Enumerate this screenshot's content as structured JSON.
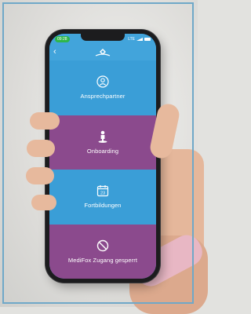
{
  "status_bar": {
    "time": "09:28",
    "carrier": "LTE"
  },
  "app_bar": {
    "back_icon": "chevron-left-icon",
    "logo": "medifox-logo"
  },
  "menu": [
    {
      "label": "Ansprechpartner",
      "icon": "contact-person-icon",
      "color": "#3a9ed7"
    },
    {
      "label": "Onboarding",
      "icon": "onboarding-person-icon",
      "color": "#8b4a8d"
    },
    {
      "label": "Fortbildungen",
      "icon": "calendar-icon",
      "color": "#3a9ed7",
      "icon_text": "23"
    },
    {
      "label": "MediFox Zugang gesperrt",
      "icon": "blocked-icon",
      "color": "#8b4a8d"
    }
  ],
  "colors": {
    "blue": "#3a9ed7",
    "purple": "#8b4a8d",
    "status_green": "#2fb64a"
  }
}
